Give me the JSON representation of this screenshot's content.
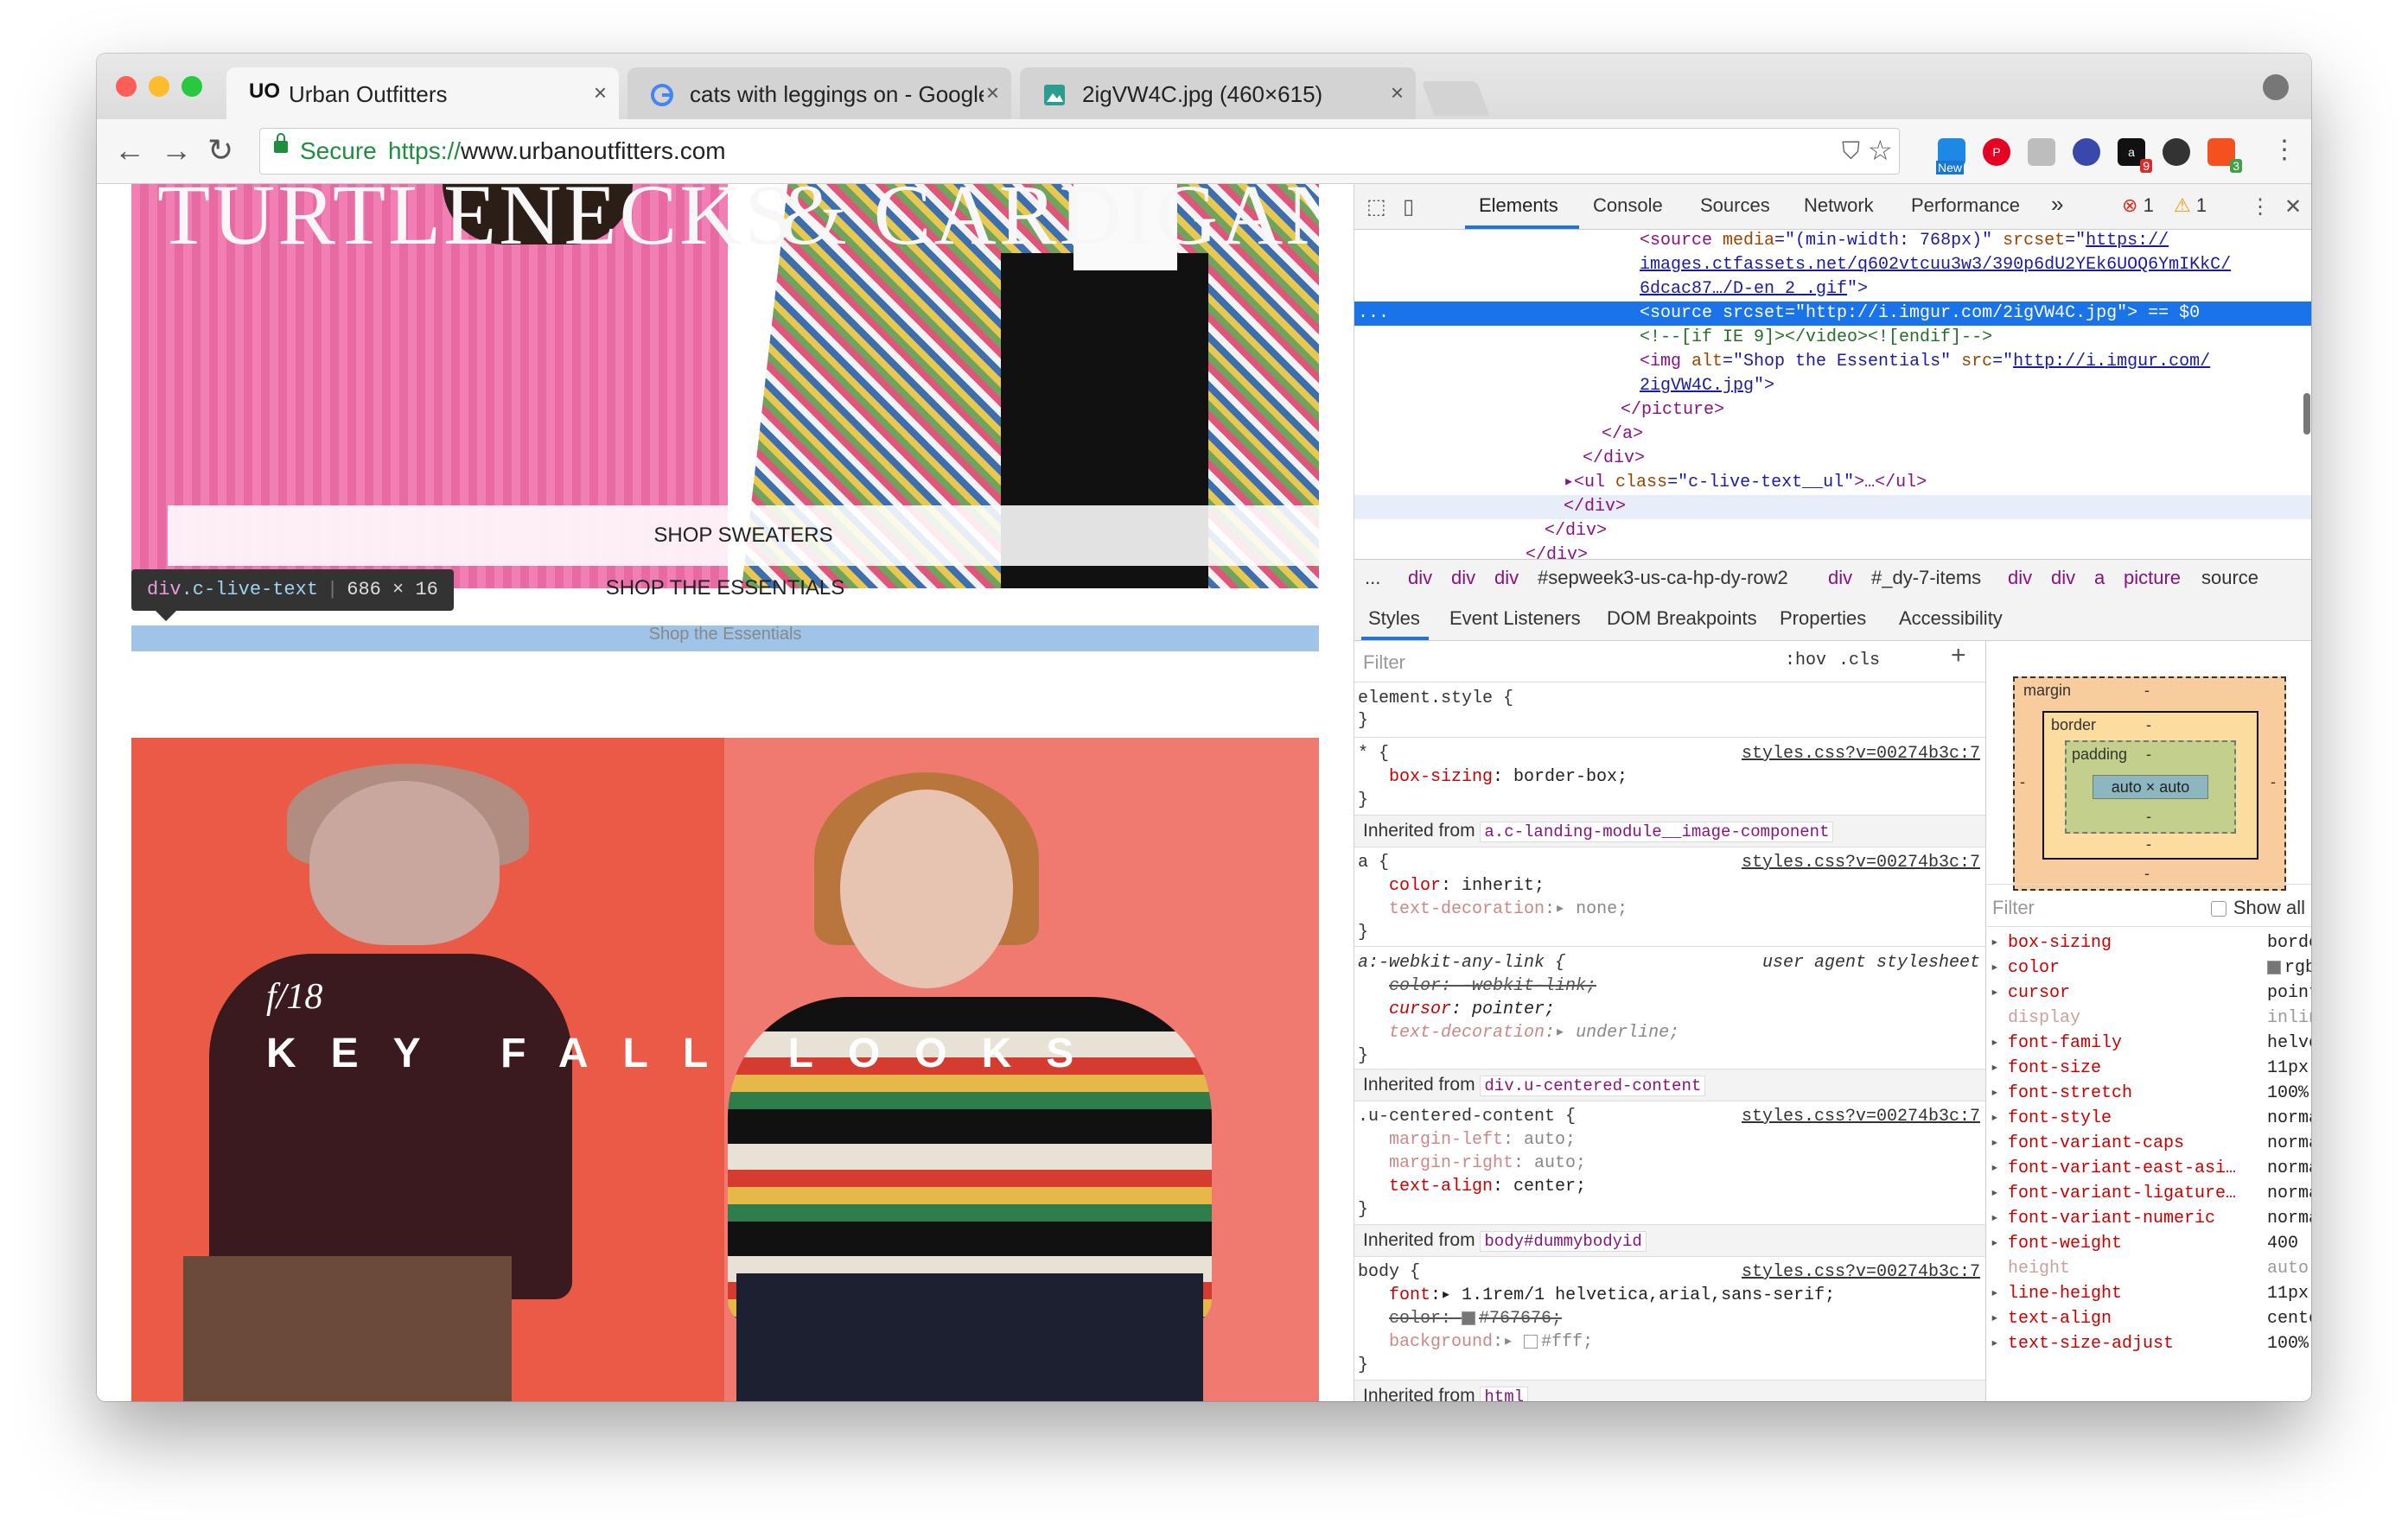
{
  "browser": {
    "tabs": [
      {
        "title": "Urban Outfitters",
        "favicon": "UO"
      },
      {
        "title": "cats with leggings on - Google",
        "favicon": "G"
      },
      {
        "title": "2igVW4C.jpg (460×615)",
        "favicon": "image-icon"
      }
    ],
    "close_glyph": "×",
    "omnibox": {
      "secure": "Secure",
      "protocol": "https://",
      "host": "www.urbanoutfitters.com"
    },
    "extension_badges": {
      "new": "New",
      "nine": "9",
      "three": "3"
    }
  },
  "page": {
    "hero1_left": "TURTLENECKS",
    "hero1_right": "& CARDIGANS",
    "shop_sweaters": "SHOP SWEATERS",
    "shop_essentials": "SHOP THE ESSENTIALS",
    "broken_img_alt": "Shop the Essentials",
    "tooltip": {
      "tag": "div",
      "cls": ".c-live-text",
      "dims": "686 × 16"
    },
    "hero2_small": "f/18",
    "hero2_title": "KEY FALL LOOKS"
  },
  "devtools": {
    "tabs": [
      "Elements",
      "Console",
      "Sources",
      "Network",
      "Performance"
    ],
    "more": "»",
    "errors": "1",
    "warnings": "1",
    "elements_lines": {
      "l1_tag": "<source",
      "l1_attr1": " media",
      "l1_val1": "=\"(min-width: 768px)\"",
      "l1_attr2": " srcset",
      "l1_eq": "=\"",
      "l1_link1": "https://",
      "l2_link": "images.ctfassets.net/q602vtcuu3w3/390p6dU2YEk6UOQ6YmIKkC/",
      "l3_link": "6dcac87…/D-en 2 .gif",
      "l3_end": "\">",
      "sel_text": "<source srcset=\"http://i.imgur.com/2igVW4C.jpg\"> == $0",
      "sel_dots": "...",
      "comment": "<!--[if IE 9]></video><![endif]-->",
      "img_tag": "<img",
      "img_attr1": " alt",
      "img_val1": "=\"Shop the Essentials\"",
      "img_attr2": " src",
      "img_eq": "=\"",
      "img_link1": "http://i.imgur.com/",
      "img_link2": "2igVW4C.jpg",
      "img_end": "\">",
      "close_picture": "</picture>",
      "close_a": "</a>",
      "close_div1": "</div>",
      "ul_open": "▸<ul",
      "ul_attr": " class",
      "ul_val": "=\"c-live-text__ul\"",
      "ul_rest": ">…</ul>",
      "close_div2": "</div>",
      "close_div3": "</div>",
      "close_div4": "</div>"
    },
    "breadcrumbs": [
      "...",
      "div",
      "div",
      "div",
      "#sepweek3-us-ca-hp-dy-row2",
      "div",
      "#_dy-7-items",
      "div",
      "div",
      "a",
      "picture",
      "source"
    ],
    "subtabs": [
      "Styles",
      "Event Listeners",
      "DOM Breakpoints",
      "Properties",
      "Accessibility"
    ],
    "styles": {
      "filter_placeholder": "Filter",
      "hov": ":hov",
      "cls": ".cls",
      "add": "+",
      "element_style": "element.style {",
      "close_brace": "}",
      "r1_sel": "* {",
      "r1_src": "styles.css?v=00274b3c:7",
      "r1_p1": "box-sizing",
      "r1_v1": ": border-box;",
      "inh1_label": "Inherited from ",
      "inh1_node": "a.c-landing-module__image-component",
      "r2_sel": "a {",
      "r2_src": "styles.css?v=00274b3c:7",
      "r2_p1": "color",
      "r2_v1": ": inherit;",
      "r2_p2": "text-decoration",
      "r2_v2": ":▸ none;",
      "r3_sel": "a:-webkit-any-link {",
      "r3_src": "user agent stylesheet",
      "r3_p1": "color: -webkit-link;",
      "r3_p2": "cursor",
      "r3_v2": ": pointer;",
      "r3_p3": "text-decoration",
      "r3_v3": ":▸ underline;",
      "inh2_label": "Inherited from ",
      "inh2_node": "div.u-centered-content",
      "r4_sel": ".u-centered-content {",
      "r4_src": "styles.css?v=00274b3c:7",
      "r4_p1": "margin-left",
      "r4_v1": ": auto;",
      "r4_p2": "margin-right",
      "r4_v2": ": auto;",
      "r4_p3": "text-align",
      "r4_v3": ": center;",
      "inh3_label": "Inherited from ",
      "inh3_node": "body#dummybodyid",
      "r5_sel": "body {",
      "r5_src": "styles.css?v=00274b3c:7",
      "r5_p1": "font",
      "r5_v1": ":▸ 1.1rem/1 helvetica,arial,sans-serif;",
      "r5_p2": "color: ",
      "r5_v2": "#767676;",
      "r5_p3": "background",
      "r5_v3": ":▸ ",
      "r5_v3b": "#fff;",
      "inh4_label": "Inherited from ",
      "inh4_node": "html"
    },
    "box_model": {
      "margin": "margin",
      "border": "border",
      "padding": "padding",
      "content": "auto × auto",
      "dash": "-"
    },
    "computed": {
      "filter_placeholder": "Filter",
      "show_all": "Show all",
      "rows": [
        {
          "name": "box-sizing",
          "value": "border…",
          "inherited": false,
          "expandable": true
        },
        {
          "name": "color",
          "value": "rgb(…",
          "inherited": false,
          "expandable": true,
          "swatch": "#767676"
        },
        {
          "name": "cursor",
          "value": "pointer",
          "inherited": false,
          "expandable": true
        },
        {
          "name": "display",
          "value": "inline",
          "inherited": true,
          "expandable": false
        },
        {
          "name": "font-family",
          "value": "helveti…",
          "inherited": false,
          "expandable": true
        },
        {
          "name": "font-size",
          "value": "11px",
          "inherited": false,
          "expandable": true
        },
        {
          "name": "font-stretch",
          "value": "100%",
          "inherited": false,
          "expandable": true
        },
        {
          "name": "font-style",
          "value": "normal",
          "inherited": false,
          "expandable": true
        },
        {
          "name": "font-variant-caps",
          "value": "normal",
          "inherited": false,
          "expandable": true
        },
        {
          "name": "font-variant-east-asi…",
          "value": "normal",
          "inherited": false,
          "expandable": true
        },
        {
          "name": "font-variant-ligature…",
          "value": "normal",
          "inherited": false,
          "expandable": true
        },
        {
          "name": "font-variant-numeric",
          "value": "normal",
          "inherited": false,
          "expandable": true
        },
        {
          "name": "font-weight",
          "value": "400",
          "inherited": false,
          "expandable": true
        },
        {
          "name": "height",
          "value": "auto",
          "inherited": true,
          "expandable": false
        },
        {
          "name": "line-height",
          "value": "11px",
          "inherited": false,
          "expandable": true
        },
        {
          "name": "text-align",
          "value": "center",
          "inherited": false,
          "expandable": true
        },
        {
          "name": "text-size-adjust",
          "value": "100%",
          "inherited": false,
          "expandable": true
        }
      ]
    }
  },
  "colors": {
    "accent": "#1a73e8",
    "secure": "#1e8e3e",
    "highlight": "#9fc4e8"
  }
}
